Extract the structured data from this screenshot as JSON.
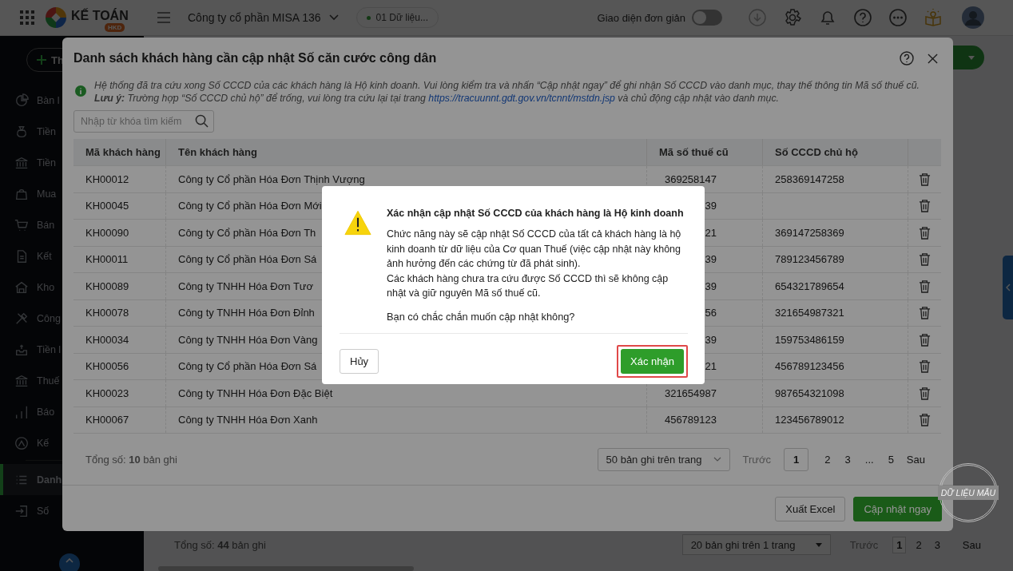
{
  "topbar": {
    "brand": "KẾ TOÁN",
    "brand_badge": "HKD",
    "company": "Công ty cổ phần MISA 136",
    "data_source": "01 Dữ liệu...",
    "simple_mode": {
      "label": "Giao diện đơn giản",
      "on": false
    }
  },
  "sidebar": {
    "add_button": "Th",
    "groups": [
      [
        {
          "label": "Bàn l",
          "selected": false
        },
        {
          "label": "Tiền",
          "selected": false
        },
        {
          "label": "Tiền",
          "selected": false
        },
        {
          "label": "Mua",
          "selected": false
        },
        {
          "label": "Bán",
          "selected": false
        },
        {
          "label": "Kết",
          "selected": false
        },
        {
          "label": "Kho",
          "selected": false
        },
        {
          "label": "Công",
          "selected": false
        },
        {
          "label": "Tiền l",
          "selected": false
        },
        {
          "label": "Thuế",
          "selected": false
        },
        {
          "label": "Báo",
          "selected": false
        },
        {
          "label": "Kế",
          "selected": false
        }
      ],
      [
        {
          "label": "Danh",
          "selected": true
        },
        {
          "label": "Số",
          "selected": false
        }
      ]
    ]
  },
  "page": {
    "total": "Tổng số: **44** bản ghi",
    "page_size": "20 bản ghi trên 1 trang",
    "pager": {
      "prev": "Trước",
      "pages": [
        {
          "label": "1",
          "selected": true
        },
        {
          "label": "2",
          "selected": false
        },
        {
          "label": "3",
          "selected": false
        }
      ],
      "next": "Sau"
    }
  },
  "dialog": {
    "title": "Danh sách khách hàng cần cập nhật Số căn cước công dân",
    "notice": {
      "text": "Hệ thống đã tra cứu xong Số CCCD của các khách hàng là Hộ kinh doanh. Vui lòng kiểm tra và nhấn “Cập nhật ngay” để ghi nhận Số CCCD vào danh mục, thay thế thông tin Mã số thuế cũ. **Lưu ý:** Trường hợp “Số CCCD chủ hộ” để trống, vui lòng tra cứu lại tại trang",
      "link": "https://tracuunnt.gdt.gov.vn/tcnnt/mstdn.jsp",
      "text_after": "và chủ động cập nhật vào danh mục."
    },
    "search": {
      "placeholder": "Nhập từ khóa tìm kiếm"
    },
    "table": {
      "columns": [
        "Mã khách hàng",
        "Tên khách hàng",
        "Mã số thuế cũ",
        "Số CCCD chủ hộ"
      ],
      "rows": [
        {
          "code": "KH00012",
          "name": "Công ty Cổ phần Hóa Đơn Thịnh Vượng",
          "tax_code": "369258147",
          "cccd": "258369147258"
        },
        {
          "code": "KH00045",
          "name": "Công ty Cổ phần Hóa Đơn Mới",
          "tax_code": "39",
          "cccd": ""
        },
        {
          "code": "KH00090",
          "name": "Công ty Cổ phần Hóa Đơn Th",
          "tax_code": "21",
          "cccd": "369147258369"
        },
        {
          "code": "KH00011",
          "name": "Công ty Cổ phần Hóa Đơn Sá",
          "tax_code": "39",
          "cccd": "789123456789"
        },
        {
          "code": "KH00089",
          "name": "Công ty TNHH Hóa Đơn Tươ",
          "tax_code": "39",
          "cccd": "654321789654"
        },
        {
          "code": "KH00078",
          "name": "Công ty TNHH Hóa Đơn Đỉnh",
          "tax_code": "56",
          "cccd": "321654987321"
        },
        {
          "code": "KH00034",
          "name": "Công ty TNHH Hóa Đơn Vàng",
          "tax_code": "39",
          "cccd": "159753486159"
        },
        {
          "code": "KH00056",
          "name": "Công ty Cổ phần Hóa Đơn Sá",
          "tax_code": "21",
          "cccd": "456789123456"
        },
        {
          "code": "KH00023",
          "name": "Công ty TNHH Hóa Đơn Đặc Biệt",
          "tax_code": "321654987",
          "cccd": "987654321098"
        },
        {
          "code": "KH00067",
          "name": "Công ty TNHH Hóa Đơn Xanh",
          "tax_code": "456789123",
          "cccd": "123456789012"
        }
      ]
    },
    "total": "Tổng số: **10** bản ghi",
    "page_size": "50 bản ghi trên trang",
    "pager": {
      "prev": "Trước",
      "pages": [
        {
          "label": "1",
          "selected": true
        },
        {
          "label": "2",
          "selected": false
        },
        {
          "label": "3",
          "selected": false
        },
        {
          "label": "...",
          "selected": false
        },
        {
          "label": "5",
          "selected": false
        }
      ],
      "next": "Sau"
    },
    "buttons": {
      "export": "Xuất Excel",
      "update": "Cập nhật ngay"
    }
  },
  "confirm": {
    "title": "Xác nhận cập nhật Số CCCD của khách hàng là Hộ kinh doanh",
    "paragraphs": [
      "Chức năng này sẽ cập nhật Số CCCD của tất cả khách hàng là hộ kinh doanh từ dữ liệu của Cơ quan Thuế (việc cập nhật này không ảnh hưởng đến các chứng từ đã phát sinh).",
      "Các khách hàng chưa tra cứu được Số CCCD thì sẽ không cập nhật và giữ nguyên Mã số thuế cũ."
    ],
    "question": "Bạn có chắc chắn muốn cập nhật không?",
    "cancel": "Hủy",
    "ok": {
      "label": "Xác nhận",
      "highlighted": true
    }
  },
  "stamp": "DỮ LIỆU MẪU"
}
